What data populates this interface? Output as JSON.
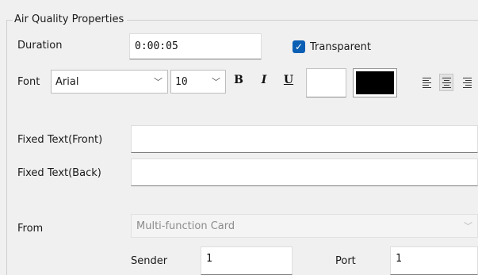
{
  "group": {
    "title": "Air Quality Properties"
  },
  "duration": {
    "label": "Duration",
    "value": "0:00:05"
  },
  "transparent": {
    "label": "Transparent",
    "checked": true,
    "check_glyph": "✓"
  },
  "font": {
    "label": "Font",
    "family": "Arial",
    "size": "10",
    "chevron": "﹀",
    "bold": "B",
    "italic": "I",
    "underline": "U",
    "fore_color": "#ffffff",
    "back_color": "#000000"
  },
  "fixed_front": {
    "label": "Fixed Text(Front)",
    "value": ""
  },
  "fixed_back": {
    "label": "Fixed Text(Back)",
    "value": ""
  },
  "from": {
    "label": "From",
    "value": "Multi-function Card",
    "chevron": "﹀"
  },
  "sender": {
    "label": "Sender",
    "value": "1"
  },
  "port": {
    "label": "Port",
    "value": "1"
  }
}
